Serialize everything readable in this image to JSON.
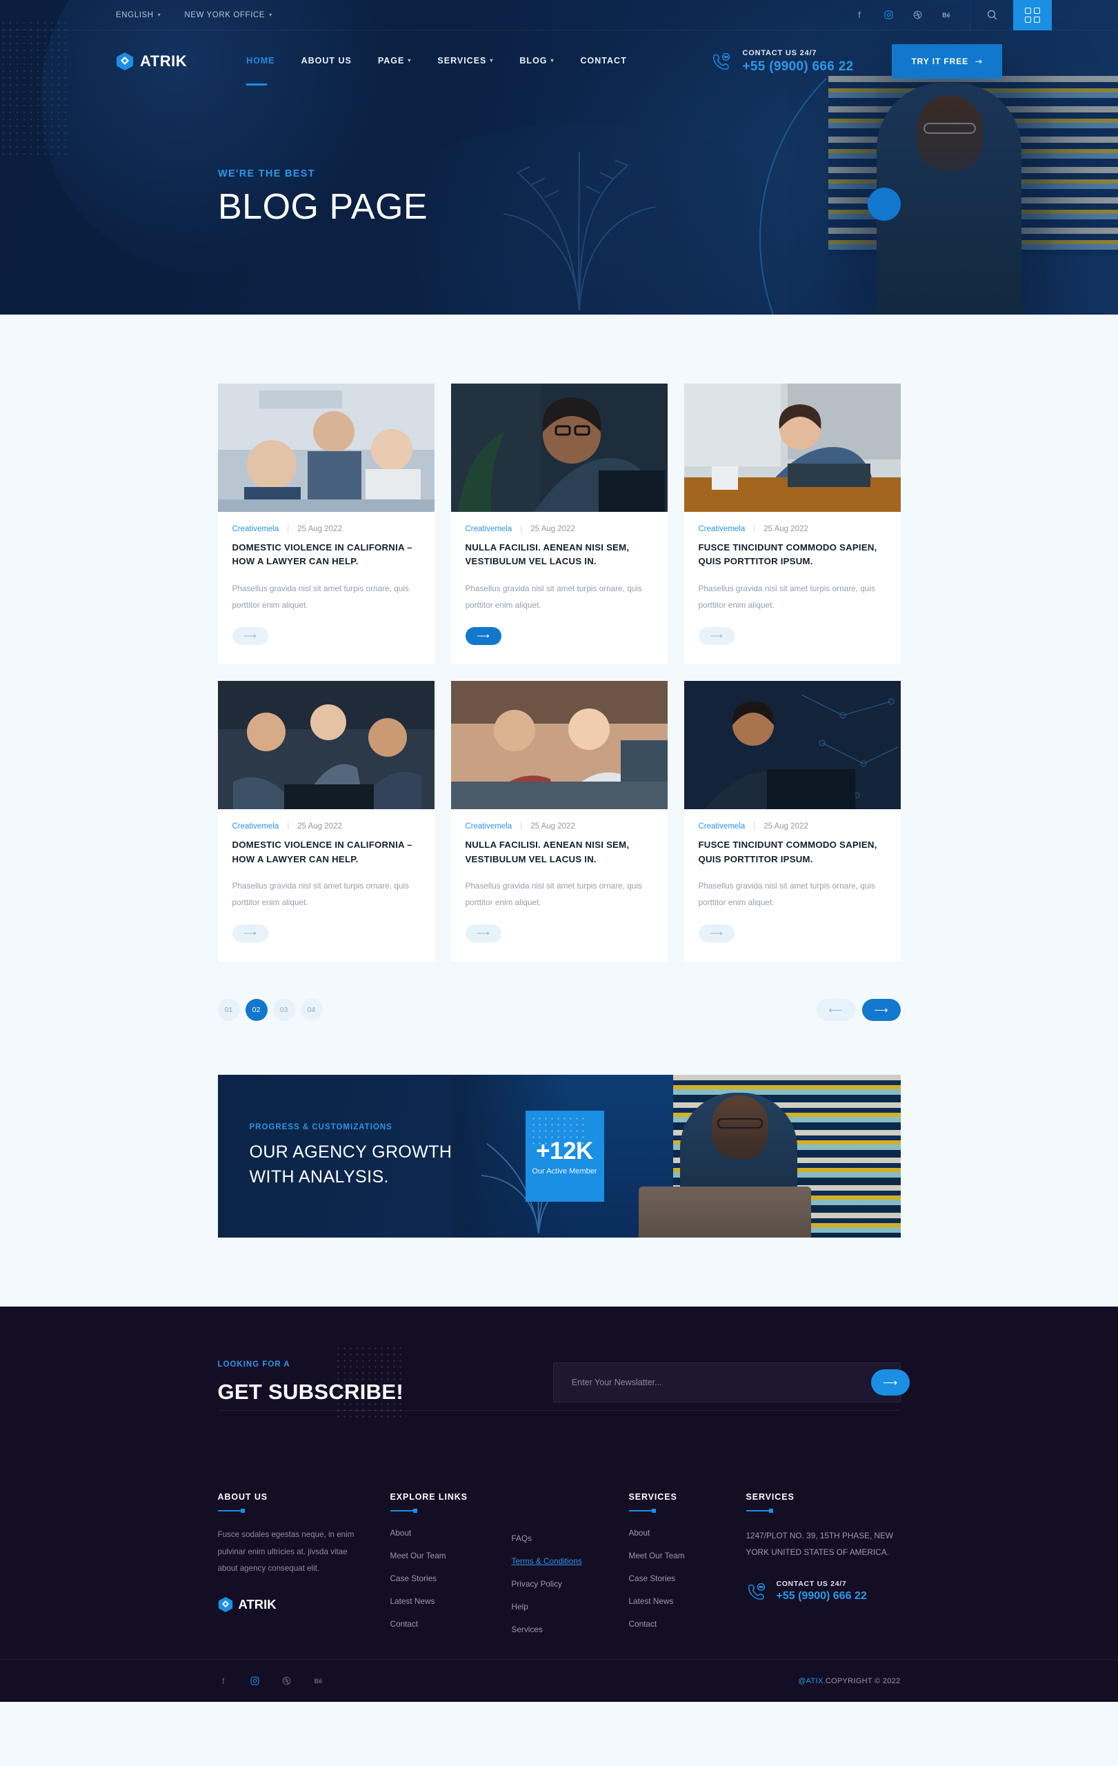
{
  "topbar": {
    "language": "ENGLISH",
    "office": "NEW YORK OFFICE",
    "socials": [
      "facebook-icon",
      "instagram-icon",
      "dribbble-icon",
      "behance-icon"
    ],
    "search": "search-icon",
    "grid": "grid-menu-icon"
  },
  "header": {
    "brand": "ATRIK",
    "nav": [
      {
        "label": "HOME",
        "active": true,
        "caret": false
      },
      {
        "label": "ABOUT US",
        "active": false,
        "caret": false
      },
      {
        "label": "PAGE",
        "active": false,
        "caret": true
      },
      {
        "label": "SERVICES",
        "active": false,
        "caret": true
      },
      {
        "label": "BLOG",
        "active": false,
        "caret": true
      },
      {
        "label": "CONTACT",
        "active": false,
        "caret": false
      }
    ],
    "contact_label": "CONTACT US 24/7",
    "contact_number": "+55 (9900) 666 22",
    "cta_label": "TRY IT FREE"
  },
  "hero": {
    "kicker": "WE'RE THE BEST",
    "title": "BLOG PAGE"
  },
  "blog": {
    "cards": [
      {
        "author": "Creativemela",
        "date": "25 Aug 2022",
        "title": "DOMESTIC VIOLENCE IN CALIFORNIA – HOW A LAWYER CAN HELP.",
        "excerpt": "Phasellus gravida nisl sit amet turpis ornare, quis porttitor enim aliquet.",
        "button_active": false,
        "image": "meeting-handshake-photo"
      },
      {
        "author": "Creativemela",
        "date": "25 Aug 2022",
        "title": "NULLA FACILISI. AENEAN NISI SEM, VESTIBULUM VEL LACUS IN.",
        "excerpt": "Phasellus gravida nisl sit amet turpis ornare, quis porttitor enim aliquet.",
        "button_active": true,
        "image": "woman-on-phone-photo"
      },
      {
        "author": "Creativemela",
        "date": "25 Aug 2022",
        "title": "FUSCE TINCIDUNT COMMODO SAPIEN, QUIS PORTTITOR IPSUM.",
        "excerpt": "Phasellus gravida nisl sit amet turpis ornare, quis porttitor enim aliquet.",
        "button_active": false,
        "image": "man-at-laptop-photo"
      },
      {
        "author": "Creativemela",
        "date": "25 Aug 2022",
        "title": "DOMESTIC VIOLENCE IN CALIFORNIA – HOW A LAWYER CAN HELP.",
        "excerpt": "Phasellus gravida nisl sit amet turpis ornare, quis porttitor enim aliquet.",
        "button_active": false,
        "image": "team-at-computers-photo"
      },
      {
        "author": "Creativemela",
        "date": "25 Aug 2022",
        "title": "NULLA FACILISI. AENEAN NISI SEM, VESTIBULUM VEL LACUS IN.",
        "excerpt": "Phasellus gravida nisl sit amet turpis ornare, quis porttitor enim aliquet.",
        "button_active": false,
        "image": "collaborating-team-photo"
      },
      {
        "author": "Creativemela",
        "date": "25 Aug 2022",
        "title": "FUSCE TINCIDUNT COMMODO SAPIEN, QUIS PORTTITOR IPSUM.",
        "excerpt": "Phasellus gravida nisl sit amet turpis ornare, quis porttitor enim aliquet.",
        "button_active": false,
        "image": "man-with-tech-overlay-photo"
      }
    ],
    "pages": [
      {
        "label": "01",
        "active": false
      },
      {
        "label": "02",
        "active": true
      },
      {
        "label": "03",
        "active": false
      },
      {
        "label": "04",
        "active": false
      }
    ],
    "prev_icon": "arrow-left-icon",
    "next_icon": "arrow-right-icon"
  },
  "growth": {
    "kicker": "PROGRESS & CUSTOMIZATIONS",
    "title_line1": "OUR AGENCY GROWTH",
    "title_line2": "WITH ANALYSIS.",
    "stat_number": "+12K",
    "stat_caption": "Our Active Member"
  },
  "subscribe": {
    "kicker": "LOOKING FOR A",
    "title": "GET SUBSCRIBE!",
    "placeholder": "Enter Your Newslatter...",
    "value": "",
    "submit_icon": "arrow-right-icon"
  },
  "footer": {
    "columns": [
      {
        "heading": "ABOUT US",
        "text": "Fusce sodales egestas neque, in enim pulvinar enim ultricies at. jivsda vitae about agency  consequat elit.",
        "logo": "ATRIK"
      },
      {
        "heading": "EXPLORE LINKS",
        "links": [
          {
            "label": "About",
            "highlight": false
          },
          {
            "label": "Meet Our Team",
            "highlight": false
          },
          {
            "label": "Case Stories",
            "highlight": false
          },
          {
            "label": "Latest News",
            "highlight": false
          },
          {
            "label": "Contact",
            "highlight": false
          }
        ]
      },
      {
        "heading": "",
        "links": [
          {
            "label": "FAQs",
            "highlight": false
          },
          {
            "label": "Terms & Conditions",
            "highlight": true
          },
          {
            "label": "Privacy Policy",
            "highlight": false
          },
          {
            "label": "Help",
            "highlight": false
          },
          {
            "label": "Services",
            "highlight": false
          }
        ]
      },
      {
        "heading": "SERVICES",
        "links": [
          {
            "label": "About",
            "highlight": false
          },
          {
            "label": "Meet Our Team",
            "highlight": false
          },
          {
            "label": "Case Stories",
            "highlight": false
          },
          {
            "label": "Latest News",
            "highlight": false
          },
          {
            "label": "Contact",
            "highlight": false
          }
        ]
      },
      {
        "heading": "SERVICES",
        "address": "1247/PLOT NO. 39, 15TH PHASE, NEW YORK UNITED STATES OF AMERICA.",
        "contact_label": "CONTACT US 24/7",
        "contact_number": "+55 (9900) 666 22"
      }
    ],
    "socials": [
      "facebook-icon",
      "instagram-icon",
      "dribbble-icon",
      "behance-icon"
    ],
    "copyright_brand": "@ATIX.",
    "copyright_text": "COPYRIGHT © 2022"
  },
  "colors": {
    "accent": "#1a8fe3",
    "accent_dark": "#1178cd",
    "hero_bg": "#0b2144",
    "page_bg": "#f4f9fd",
    "footer_bg": "#130e24"
  }
}
